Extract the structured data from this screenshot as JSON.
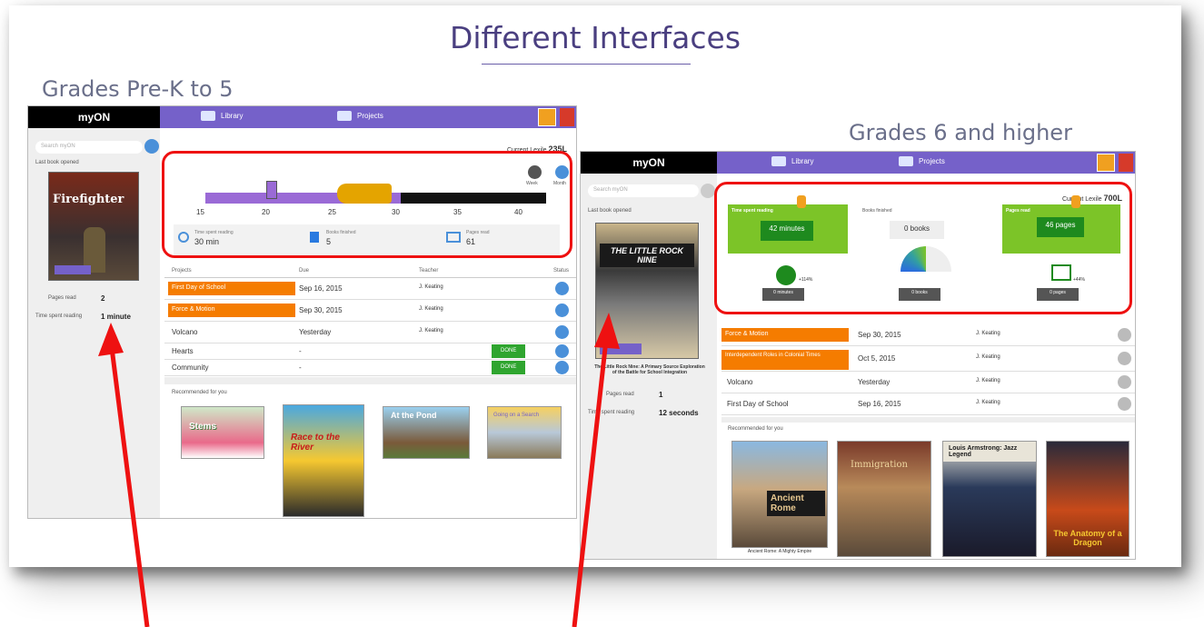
{
  "slide": {
    "title": "Different Interfaces",
    "left_label": "Grades Pre-K to 5",
    "right_label": "Grades 6 and higher"
  },
  "colors": {
    "accent_purple": "#7561c9",
    "orange": "#f57c00",
    "green": "#2fa52f",
    "highlight_red": "#e11111"
  },
  "left_app": {
    "logo": "myON",
    "nav": [
      "Library",
      "Projects"
    ],
    "search_placeholder": "Search myON",
    "current_lexile_label": "Current Lexile",
    "current_lexile_value": "235L",
    "last_book_label": "Last book opened",
    "last_book_title": "Firefighter",
    "pages_read_label": "Pages read",
    "pages_read_value": "2",
    "time_spent_label": "Time spent reading",
    "time_spent_value": "1 minute",
    "goal_ticks": [
      "15",
      "20",
      "25",
      "30",
      "35",
      "40"
    ],
    "tick_unit": "minutes",
    "toggles": [
      "Week",
      "Month"
    ],
    "stats": [
      {
        "label": "Time spent reading",
        "value": "30 min"
      },
      {
        "label": "Books finished",
        "value": "5"
      },
      {
        "label": "Pages read",
        "value": "61"
      }
    ],
    "table_headers": [
      "Projects",
      "Due",
      "Teacher",
      "Status"
    ],
    "projects": [
      {
        "name": "First Day of School",
        "due": "Sep 16, 2015",
        "teacher": "J. Keating",
        "highlight": true,
        "done": false
      },
      {
        "name": "Force & Motion",
        "due": "Sep 30, 2015",
        "teacher": "J. Keating",
        "highlight": true,
        "done": false
      },
      {
        "name": "Volcano",
        "due": "Yesterday",
        "teacher": "J. Keating",
        "highlight": false,
        "done": false
      },
      {
        "name": "Hearts",
        "due": "-",
        "teacher": "",
        "highlight": false,
        "done": true
      },
      {
        "name": "Community",
        "due": "-",
        "teacher": "",
        "highlight": false,
        "done": true
      }
    ],
    "done_label": "DONE",
    "recommended_label": "Recommended for you",
    "recommended": [
      "Stems",
      "Race to the River",
      "At the Pond",
      "Going on a Search"
    ]
  },
  "right_app": {
    "logo": "myON",
    "nav": [
      "Library",
      "Projects"
    ],
    "search_placeholder": "Search myON",
    "current_lexile_label": "Current Lexile",
    "current_lexile_value": "700L",
    "last_book_label": "Last book opened",
    "last_book_title": "THE LITTLE ROCK NINE",
    "last_book_caption": "The Little Rock Nine: A Primary Source Exploration of the Battle for School Integration",
    "pages_read_label": "Pages read",
    "pages_read_value": "1",
    "time_spent_label": "Time spent reading",
    "time_spent_value": "12 seconds",
    "metrics": [
      {
        "label": "Time spent reading",
        "value": "42 minutes",
        "sub": "0 minutes",
        "change": "+114%"
      },
      {
        "label": "Books finished",
        "value": "0 books",
        "sub": "0 books",
        "change": ""
      },
      {
        "label": "Pages read",
        "value": "46 pages",
        "sub": "0 pages",
        "change": "+44%"
      }
    ],
    "projects": [
      {
        "name": "Force & Motion",
        "due": "Sep 30, 2015",
        "teacher": "J. Keating",
        "highlight": true
      },
      {
        "name": "Interdependent Roles in Colonial Times",
        "due": "Oct 5, 2015",
        "teacher": "J. Keating",
        "highlight": true
      },
      {
        "name": "Volcano",
        "due": "Yesterday",
        "teacher": "J. Keating",
        "highlight": false
      },
      {
        "name": "First Day of School",
        "due": "Sep 16, 2015",
        "teacher": "J. Keating",
        "highlight": false
      }
    ],
    "recommended_label": "Recommended for you",
    "recommended": [
      "Ancient Rome",
      "Immigration",
      "Louis Armstrong: Jazz Legend",
      "The Anatomy of a Dragon"
    ],
    "recommended_caption": "Ancient Rome: A Mighty Empire"
  }
}
